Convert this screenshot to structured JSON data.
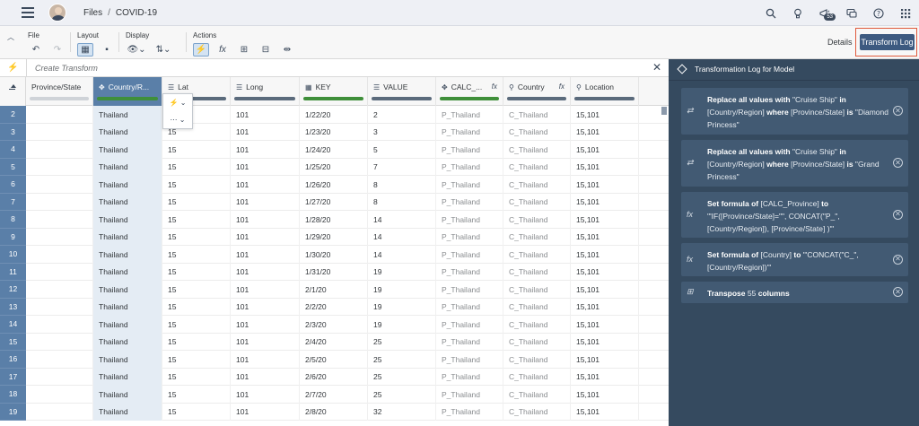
{
  "shell": {
    "breadcrumb_files": "Files",
    "breadcrumb_sep": "/",
    "breadcrumb_current": "COVID-19",
    "notification_count": "53"
  },
  "toolbar": {
    "file_label": "File",
    "layout_label": "Layout",
    "display_label": "Display",
    "actions_label": "Actions",
    "details_label": "Details",
    "transform_log_label": "Transform Log"
  },
  "transform_bar": {
    "placeholder": "Create Transform"
  },
  "columns": [
    {
      "label": "Province/State",
      "icon": "",
      "fx": ""
    },
    {
      "label": "Country/R...",
      "icon": "✥",
      "fx": ""
    },
    {
      "label": "Lat",
      "icon": "☰",
      "fx": ""
    },
    {
      "label": "Long",
      "icon": "☰",
      "fx": ""
    },
    {
      "label": "KEY",
      "icon": "▦",
      "fx": ""
    },
    {
      "label": "VALUE",
      "icon": "☰",
      "fx": ""
    },
    {
      "label": "CALC_...",
      "icon": "✥",
      "fx": "fx"
    },
    {
      "label": "Country",
      "icon": "⚲",
      "fx": "fx"
    },
    {
      "label": "Location",
      "icon": "⚲",
      "fx": ""
    }
  ],
  "rows": [
    {
      "n": "2",
      "country": "Thailand",
      "lat": "15",
      "long": "101",
      "key": "1/22/20",
      "value": "2",
      "calc": "P_Thailand",
      "ctry": "C_Thailand",
      "loc": "15,101"
    },
    {
      "n": "3",
      "country": "Thailand",
      "lat": "15",
      "long": "101",
      "key": "1/23/20",
      "value": "3",
      "calc": "P_Thailand",
      "ctry": "C_Thailand",
      "loc": "15,101"
    },
    {
      "n": "4",
      "country": "Thailand",
      "lat": "15",
      "long": "101",
      "key": "1/24/20",
      "value": "5",
      "calc": "P_Thailand",
      "ctry": "C_Thailand",
      "loc": "15,101"
    },
    {
      "n": "5",
      "country": "Thailand",
      "lat": "15",
      "long": "101",
      "key": "1/25/20",
      "value": "7",
      "calc": "P_Thailand",
      "ctry": "C_Thailand",
      "loc": "15,101"
    },
    {
      "n": "6",
      "country": "Thailand",
      "lat": "15",
      "long": "101",
      "key": "1/26/20",
      "value": "8",
      "calc": "P_Thailand",
      "ctry": "C_Thailand",
      "loc": "15,101"
    },
    {
      "n": "7",
      "country": "Thailand",
      "lat": "15",
      "long": "101",
      "key": "1/27/20",
      "value": "8",
      "calc": "P_Thailand",
      "ctry": "C_Thailand",
      "loc": "15,101"
    },
    {
      "n": "8",
      "country": "Thailand",
      "lat": "15",
      "long": "101",
      "key": "1/28/20",
      "value": "14",
      "calc": "P_Thailand",
      "ctry": "C_Thailand",
      "loc": "15,101"
    },
    {
      "n": "9",
      "country": "Thailand",
      "lat": "15",
      "long": "101",
      "key": "1/29/20",
      "value": "14",
      "calc": "P_Thailand",
      "ctry": "C_Thailand",
      "loc": "15,101"
    },
    {
      "n": "10",
      "country": "Thailand",
      "lat": "15",
      "long": "101",
      "key": "1/30/20",
      "value": "14",
      "calc": "P_Thailand",
      "ctry": "C_Thailand",
      "loc": "15,101"
    },
    {
      "n": "11",
      "country": "Thailand",
      "lat": "15",
      "long": "101",
      "key": "1/31/20",
      "value": "19",
      "calc": "P_Thailand",
      "ctry": "C_Thailand",
      "loc": "15,101"
    },
    {
      "n": "12",
      "country": "Thailand",
      "lat": "15",
      "long": "101",
      "key": "2/1/20",
      "value": "19",
      "calc": "P_Thailand",
      "ctry": "C_Thailand",
      "loc": "15,101"
    },
    {
      "n": "13",
      "country": "Thailand",
      "lat": "15",
      "long": "101",
      "key": "2/2/20",
      "value": "19",
      "calc": "P_Thailand",
      "ctry": "C_Thailand",
      "loc": "15,101"
    },
    {
      "n": "14",
      "country": "Thailand",
      "lat": "15",
      "long": "101",
      "key": "2/3/20",
      "value": "19",
      "calc": "P_Thailand",
      "ctry": "C_Thailand",
      "loc": "15,101"
    },
    {
      "n": "15",
      "country": "Thailand",
      "lat": "15",
      "long": "101",
      "key": "2/4/20",
      "value": "25",
      "calc": "P_Thailand",
      "ctry": "C_Thailand",
      "loc": "15,101"
    },
    {
      "n": "16",
      "country": "Thailand",
      "lat": "15",
      "long": "101",
      "key": "2/5/20",
      "value": "25",
      "calc": "P_Thailand",
      "ctry": "C_Thailand",
      "loc": "15,101"
    },
    {
      "n": "17",
      "country": "Thailand",
      "lat": "15",
      "long": "101",
      "key": "2/6/20",
      "value": "25",
      "calc": "P_Thailand",
      "ctry": "C_Thailand",
      "loc": "15,101"
    },
    {
      "n": "18",
      "country": "Thailand",
      "lat": "15",
      "long": "101",
      "key": "2/7/20",
      "value": "25",
      "calc": "P_Thailand",
      "ctry": "C_Thailand",
      "loc": "15,101"
    },
    {
      "n": "19",
      "country": "Thailand",
      "lat": "15",
      "long": "101",
      "key": "2/8/20",
      "value": "32",
      "calc": "P_Thailand",
      "ctry": "C_Thailand",
      "loc": "15,101"
    }
  ],
  "log_panel": {
    "title": "Transformation Log for Model",
    "entries": [
      {
        "b1": "Replace all values with",
        "t1": " \"Cruise Ship\" ",
        "b2": "in",
        "t2": " [Country/Region] ",
        "b3": "where",
        "t3": " [Province/State] ",
        "b4": "is",
        "t4": " \"Diamond Princess\""
      },
      {
        "b1": "Replace all values with",
        "t1": " \"Cruise Ship\" ",
        "b2": "in",
        "t2": " [Country/Region] ",
        "b3": "where",
        "t3": " [Province/State] ",
        "b4": "is",
        "t4": " \"Grand Princess\""
      },
      {
        "b1": "Set formula of",
        "t1": " [CALC_Province] ",
        "b2": "to",
        "t2": " '\"IF([Province/State]=\"\", CONCAT(\"P_\", [Country/Region]), [Province/State] )'\"",
        "b3": "",
        "t3": "",
        "b4": "",
        "t4": ""
      },
      {
        "b1": "Set formula of",
        "t1": " [Country] ",
        "b2": "to",
        "t2": " '\"CONCAT(\"C_\", [Country/Region])'\"",
        "b3": "",
        "t3": "",
        "b4": "",
        "t4": ""
      },
      {
        "b1": "Transpose",
        "t1": " 55 ",
        "b2": "columns",
        "t2": "",
        "b3": "",
        "t3": "",
        "b4": "",
        "t4": ""
      }
    ]
  }
}
